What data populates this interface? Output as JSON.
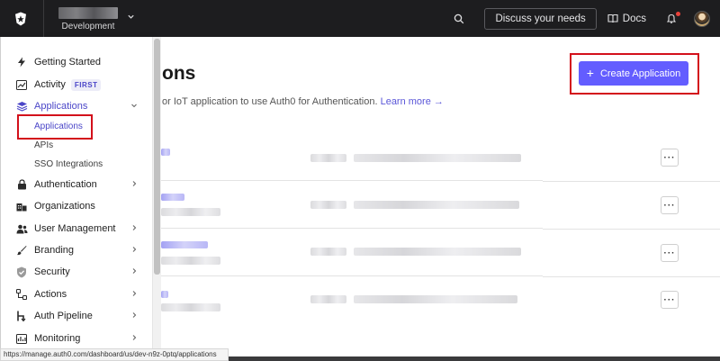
{
  "topbar": {
    "tenant_env": "Development",
    "discuss_label": "Discuss your needs",
    "docs_label": "Docs"
  },
  "sidebar": {
    "items": [
      {
        "label": "Getting Started",
        "icon": "lightning-icon"
      },
      {
        "label": "Activity",
        "icon": "activity-chart-icon",
        "badge": "FIRST"
      },
      {
        "label": "Applications",
        "icon": "layers-icon"
      },
      {
        "label": "Authentication",
        "icon": "lock-icon"
      },
      {
        "label": "Organizations",
        "icon": "building-icon"
      },
      {
        "label": "User Management",
        "icon": "users-icon"
      },
      {
        "label": "Branding",
        "icon": "brush-icon"
      },
      {
        "label": "Security",
        "icon": "shield-check-icon"
      },
      {
        "label": "Actions",
        "icon": "actions-flow-icon"
      },
      {
        "label": "Auth Pipeline",
        "icon": "pipeline-icon"
      },
      {
        "label": "Monitoring",
        "icon": "monitor-icon"
      }
    ],
    "sub_items": [
      {
        "label": "Applications"
      },
      {
        "label": "APIs"
      },
      {
        "label": "SSO Integrations"
      }
    ]
  },
  "main": {
    "title_fragment": "ons",
    "description": "or IoT application to use Auth0 for Authentication.",
    "learn_more": "Learn more →",
    "create_button": "Create Application"
  },
  "status_url": "https://manage.auth0.com/dashboard/us/dev-n9z-0ptq/applications",
  "colors": {
    "accent": "#635dff",
    "active_text": "#4b46c8",
    "highlight_border": "#d3101b",
    "topbar_bg": "#1d1d1f"
  }
}
